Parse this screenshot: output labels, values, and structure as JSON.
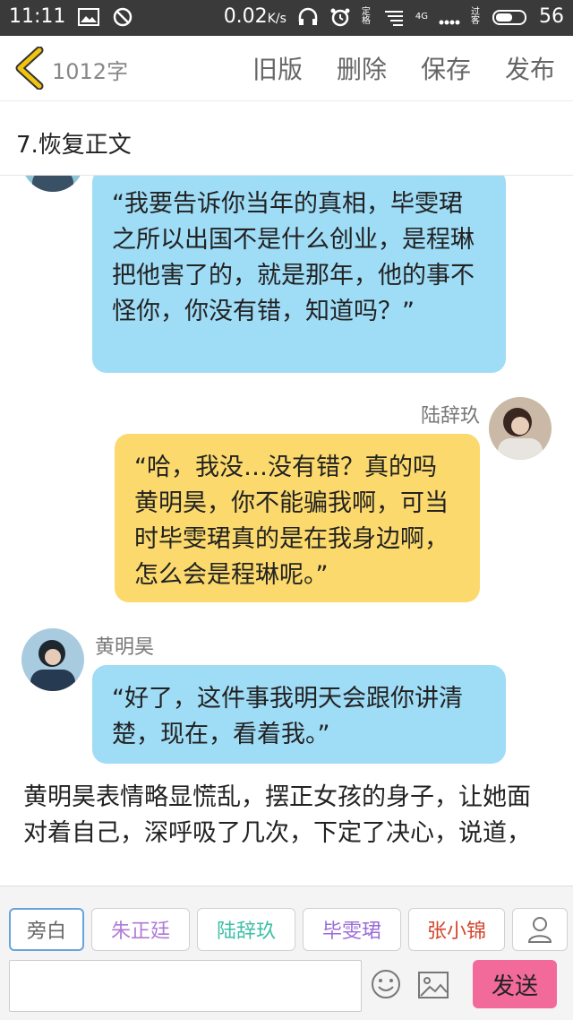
{
  "status_bar": {
    "time": "11:11",
    "speed": "0.02",
    "speed_unit": "K/s",
    "carrier_label_1": "定格",
    "network": "4G",
    "carrier_label_2": "过客",
    "battery": "56"
  },
  "header": {
    "word_count": "1012字",
    "actions": {
      "old_version": "旧版",
      "delete": "删除",
      "save": "保存",
      "publish": "发布"
    }
  },
  "chapter_title": "7.恢复正文",
  "messages": [
    {
      "speaker": "",
      "side": "left",
      "color": "#9fdcf6",
      "text": "“我要告诉你当年的真相，毕雯珺之所以出国不是什么创业，是程琳把他害了的，就是那年，他的事不怪你，你没有错，知道吗？”"
    },
    {
      "speaker": "陆辞玖",
      "side": "right",
      "color": "#fbd96c",
      "text": "“哈，我没…没有错？真的吗黄明昊，你不能骗我啊，可当时毕雯珺真的是在我身边啊，怎么会是程琳呢。”"
    },
    {
      "speaker": "黄明昊",
      "side": "left",
      "color": "#9fdcf6",
      "text": "“好了，这件事我明天会跟你讲清楚，现在，看着我。”"
    }
  ],
  "narration": "黄明昊表情略显慌乱，摆正女孩的身子，让她面对着自己，深呼吸了几次，下定了决心，说道，",
  "roles": [
    {
      "label": "旁白",
      "color": "#666666"
    },
    {
      "label": "朱正廷",
      "color": "#b07ad6"
    },
    {
      "label": "陆辞玖",
      "color": "#3dbfa8"
    },
    {
      "label": "毕雯珺",
      "color": "#9b6ed8"
    },
    {
      "label": "张小锦",
      "color": "#d2462e"
    }
  ],
  "input": {
    "value": "",
    "placeholder": ""
  },
  "send_label": "发送",
  "icons": {
    "back": "chevron-left-icon",
    "emoji": "smiley-icon",
    "image": "image-icon",
    "user": "user-icon"
  },
  "colors": {
    "accent_back": "#f1c40f",
    "bubble_blue": "#9fdcf6",
    "bubble_yellow": "#fbd96c",
    "send": "#f26a9a"
  }
}
